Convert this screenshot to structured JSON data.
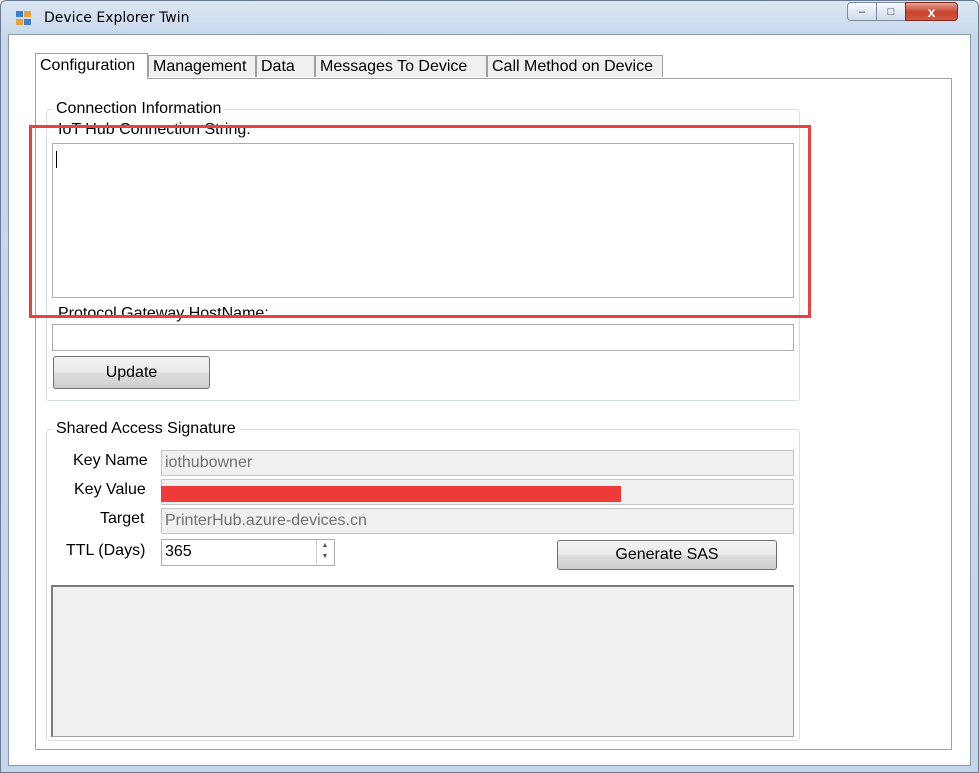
{
  "window": {
    "title": "Device Explorer Twin"
  },
  "caption_buttons": {
    "minimize": "–",
    "maximize": "□",
    "close": "x"
  },
  "tabs": [
    {
      "label": "Configuration"
    },
    {
      "label": "Management"
    },
    {
      "label": "Data"
    },
    {
      "label": "Messages To Device"
    },
    {
      "label": "Call Method on Device"
    }
  ],
  "connection": {
    "group_title": "Connection Information",
    "conn_string_label": "IoT Hub Connection String:",
    "conn_string_value": "",
    "gateway_label": "Protocol Gateway HostName:",
    "gateway_value": "",
    "update_button": "Update"
  },
  "sas": {
    "group_title": "Shared Access Signature",
    "key_name_label": "Key Name",
    "key_name_value": "iothubowner",
    "key_value_label": "Key Value",
    "target_label": "Target",
    "target_value": "PrinterHub.azure-devices.cn",
    "ttl_label": "TTL (Days)",
    "ttl_value": "365",
    "generate_button": "Generate SAS",
    "output_value": ""
  },
  "colors": {
    "highlight": "#e8413f",
    "redaction": "#ef3a3a"
  }
}
